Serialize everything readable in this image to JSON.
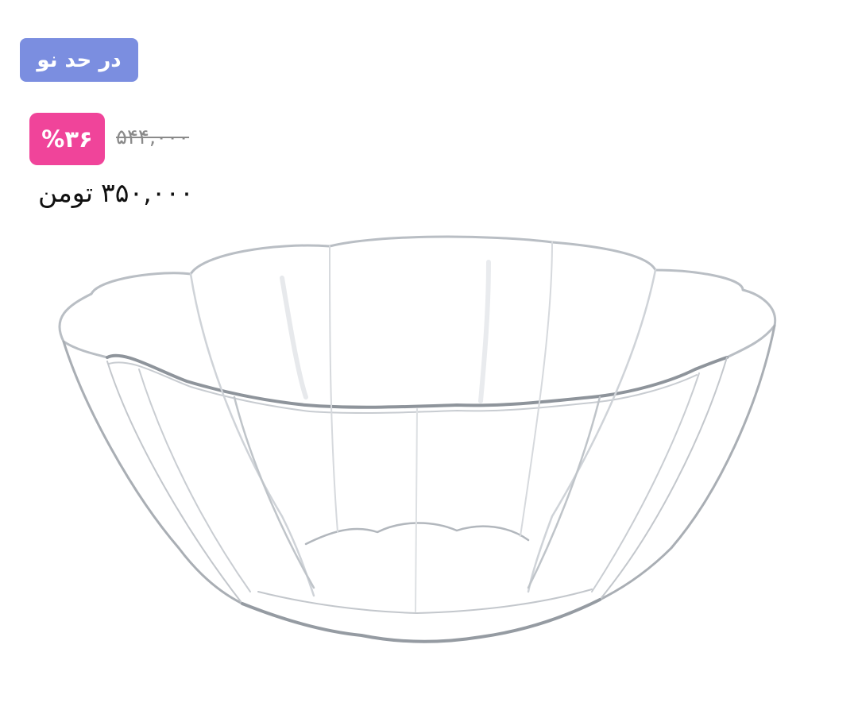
{
  "product": {
    "condition_label": "در حد نو",
    "discount_label": "%۳۶",
    "old_price": "۵۴۴,۰۰۰",
    "price_amount": "۳۵۰,۰۰۰",
    "price_currency": "تومن",
    "image_icon": "glass-fluted-bowl"
  },
  "colors": {
    "condition_badge": "#7b8ee0",
    "discount_badge": "#f0449a",
    "old_price": "#8a8a8a",
    "price": "#111111"
  }
}
